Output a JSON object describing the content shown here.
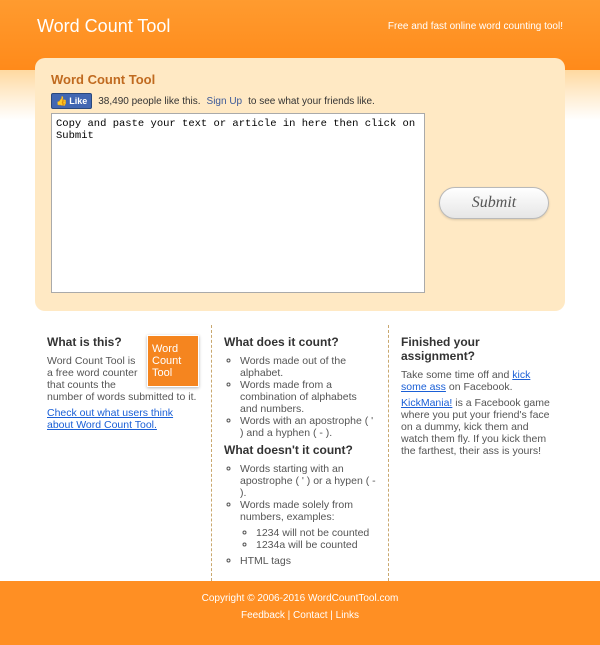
{
  "header": {
    "title": "Word Count Tool",
    "tagline": "Free and fast online word counting tool!"
  },
  "card": {
    "title": "Word Count Tool",
    "fb": {
      "like_label": "Like",
      "count_text": "38,490 people like this.",
      "signup_label": "Sign Up",
      "signup_tail": " to see what your friends like."
    },
    "textarea_value": "Copy and paste your text or article in here then click on Submit",
    "submit_label": "Submit"
  },
  "col1": {
    "heading": "What is this?",
    "logo_text": "Word Count Tool",
    "para": "Word Count Tool is a free word counter that counts the number of words submitted to it.",
    "link_text": "Check out what users think about Word Count Tool."
  },
  "col2": {
    "heading1": "What does it count?",
    "items1": {
      "0": "Words made out of the alphabet.",
      "1": "Words made from a combination of alphabets and numbers.",
      "2": "Words with an apostrophe ( ' ) and a hyphen ( - )."
    },
    "heading2": "What doesn't it count?",
    "items2": {
      "0": "Words starting with an apostrophe ( ' ) or a hypen ( - ).",
      "1": "Words made solely from numbers, examples:",
      "1a": "1234 will not be counted",
      "1b": "1234a will be counted",
      "2": "HTML tags"
    }
  },
  "col3": {
    "heading": "Finished your assignment?",
    "p1a": "Take some time off and ",
    "p1link": "kick some ass",
    "p1b": " on Facebook.",
    "p2link": "KickMania!",
    "p2b": " is a Facebook game where you put your friend's face on a dummy, kick them and watch them fly. If you kick them the farthest, their ass is yours!"
  },
  "footer": {
    "copyright": "Copyright © 2006-2016 WordCountTool.com",
    "links": {
      "feedback": "Feedback",
      "contact": "Contact",
      "links": "Links"
    },
    "sep": " | "
  }
}
